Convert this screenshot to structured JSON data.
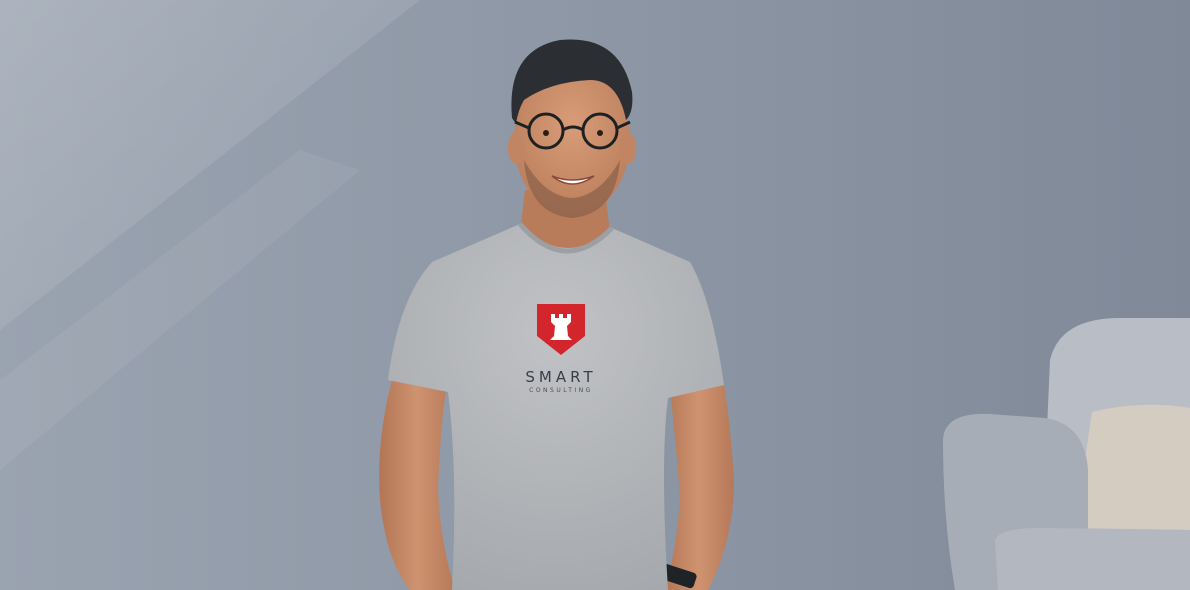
{
  "photo": {
    "subject": "smiling-man-in-grey-tshirt",
    "background_color": "#8e98a6",
    "shirt_color": "#b5b7ba",
    "skin_color": "#c98d6a"
  },
  "shirt_logo": {
    "emblem_icon": "rook-shield-icon",
    "emblem_color": "#d3262c",
    "wordmark": "SMART",
    "tagline": "CONSULTING"
  }
}
